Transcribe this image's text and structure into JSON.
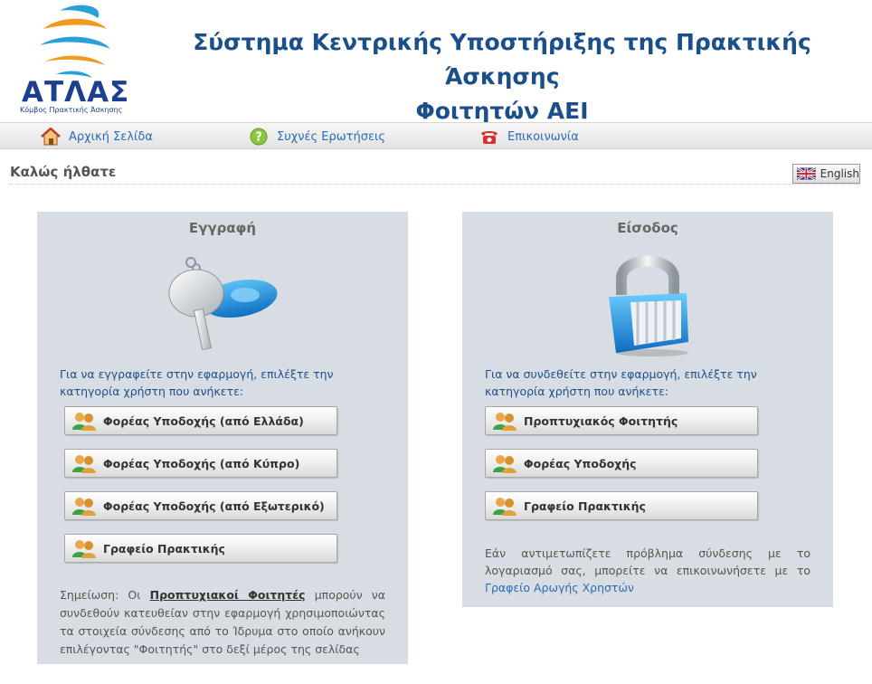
{
  "logo": {
    "name": "ΑΤΛΑΣ",
    "subtitle": "Κόμβος Πρακτικής Άσκησης"
  },
  "header": {
    "title_line1": "Σύστημα Κεντρικής Υποστήριξης της Πρακτικής Άσκησης",
    "title_line2": "Φοιτητών ΑΕΙ"
  },
  "nav": {
    "home": "Αρχική Σελίδα",
    "faq": "Συχνές Ερωτήσεις",
    "contact": "Επικοινωνία"
  },
  "welcome": "Καλώς ήλθατε",
  "language_button": "English",
  "register": {
    "title": "Εγγραφή",
    "intro": "Για να εγγραφείτε στην εφαρμογή, επιλέξτε την κατηγορία χρήστη που ανήκετε:",
    "buttons": [
      "Φορέας Υποδοχής (από Ελλάδα)",
      "Φορέας Υποδοχής (από Κύπρο)",
      "Φορέας Υποδοχής (από Εξωτερικό)",
      "Γραφείο Πρακτικής"
    ],
    "note_prefix": "Σημείωση: Οι",
    "note_link": "Προπτυχιακοί Φοιτητές",
    "note_suffix": "μπορούν να συνδεθούν κατευθείαν στην εφαρμογή χρησιμοποιώντας τα στοιχεία σύνδεσης από το Ίδρυμα στο οποίο ανήκουν επιλέγοντας \"Φοιτητής\" στο δεξί μέρος της σελίδας"
  },
  "login": {
    "title": "Είσοδος",
    "intro": "Για να συνδεθείτε στην εφαρμογή, επιλέξτε την κατηγορία χρήστη που ανήκετε:",
    "buttons": [
      "Προπτυχιακός Φοιτητής",
      "Φορέας Υποδοχής",
      "Γραφείο Πρακτικής"
    ],
    "help_text": "Εάν αντιμετωπίζετε πρόβλημα σύνδεσης με το λογαριασμό σας, μπορείτε να επικοινωνήσετε με το",
    "help_link": "Γραφείο Αρωγής Χρηστών"
  },
  "colors": {
    "title_blue": "#1b4f8a",
    "link_blue": "#2a6cb3",
    "panel_bg": "#d8dde3"
  },
  "icons": {
    "home": "home-icon",
    "faq": "help-icon",
    "contact": "phone-icon",
    "flag": "uk-flag-icon",
    "users": "users-icon",
    "key": "key-icon",
    "lock": "padlock-icon"
  }
}
